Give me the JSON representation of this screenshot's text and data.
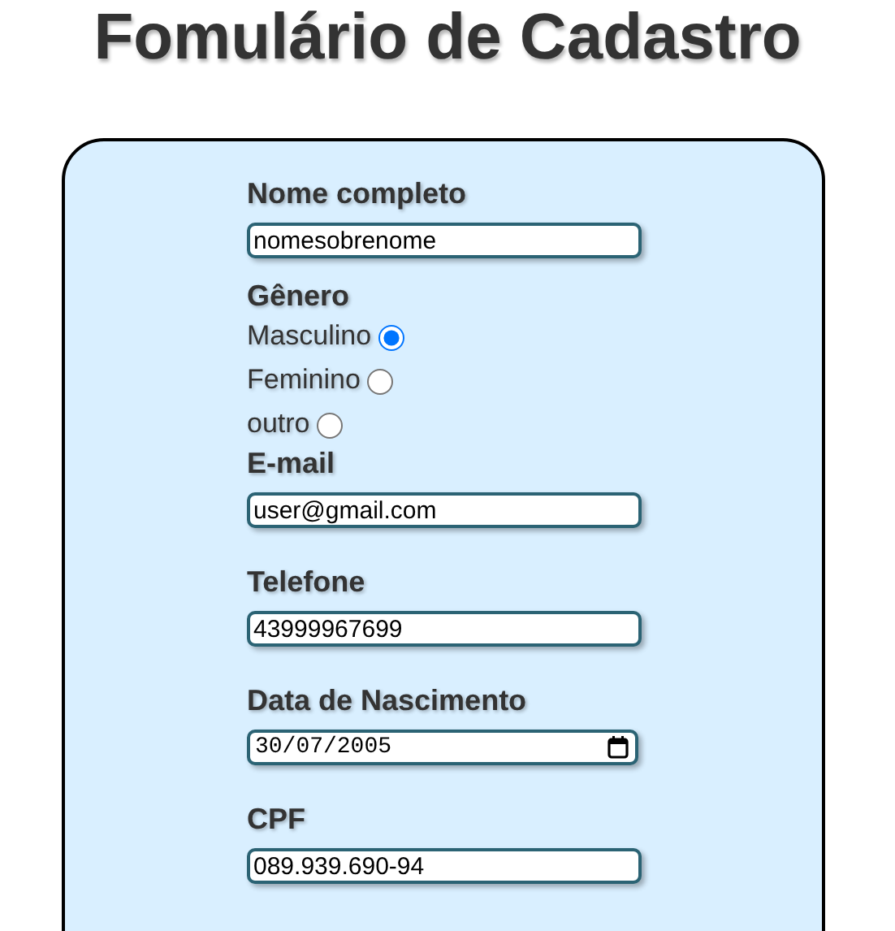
{
  "title": "Fomulário de Cadastro",
  "fields": [
    {
      "kind": "text",
      "label": "Nome completo",
      "value": "nomesobrenome"
    },
    {
      "kind": "radio",
      "label": "Gênero",
      "options": [
        {
          "label": "Masculino",
          "selected": true
        },
        {
          "label": "Feminino",
          "selected": false
        },
        {
          "label": "outro",
          "selected": false
        }
      ]
    },
    {
      "kind": "text",
      "label": "E-mail",
      "value": "user@gmail.com"
    },
    {
      "kind": "text",
      "label": "Telefone",
      "value": "43999967699"
    },
    {
      "kind": "date",
      "label": "Data de Nascimento",
      "value": "30/07/2005"
    },
    {
      "kind": "text",
      "label": "CPF",
      "value": "089.939.690-94"
    }
  ]
}
